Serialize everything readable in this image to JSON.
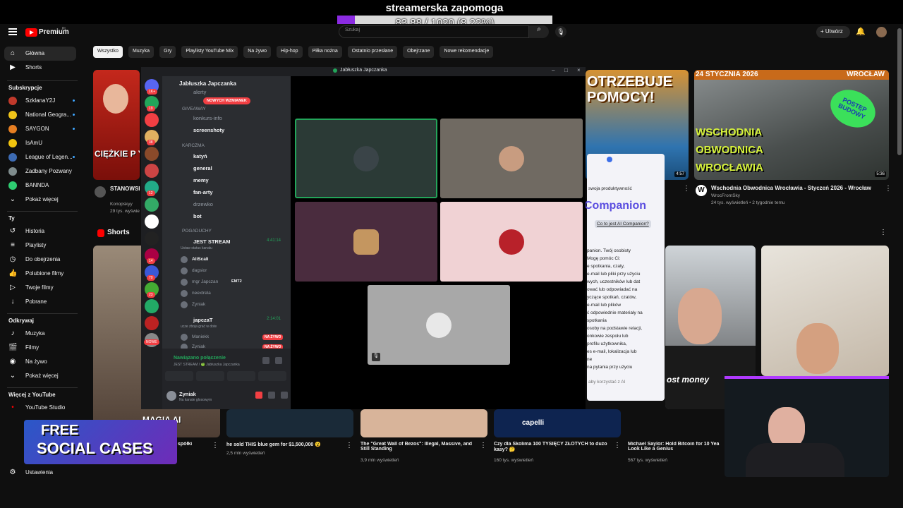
{
  "stream": {
    "title": "streamerska zapomoga",
    "progress_label": "83.88 / 1020 (8.22%)",
    "progress_fraction": 0.0822
  },
  "header": {
    "logo_text": "Premium",
    "country_code": "PL",
    "search_placeholder": "Szukaj",
    "create_label": "Utwórz",
    "icons": [
      "menu-icon",
      "search-icon",
      "mic-icon",
      "bell-icon",
      "avatar"
    ]
  },
  "sidebar": {
    "main": [
      {
        "label": "Główna",
        "icon": "home-icon",
        "active": true
      },
      {
        "label": "Shorts",
        "icon": "shorts-icon"
      }
    ],
    "subs_heading": "Subskrypcje",
    "subs": [
      {
        "label": "SzklanaY2J",
        "color": "#c0392b",
        "dot": true
      },
      {
        "label": "National Geogra...",
        "color": "#f0c419",
        "dot": true
      },
      {
        "label": "SAYGON",
        "color": "#e67e22",
        "dot": true
      },
      {
        "label": "IsAmU",
        "color": "#f1c40f",
        "dot": false
      },
      {
        "label": "League of Legen...",
        "color": "#3d6bb3",
        "dot": true
      },
      {
        "label": "Zadbany Pozwany",
        "color": "#7f8c8d",
        "dot": false
      },
      {
        "label": "BANNDA",
        "color": "#2ecc71",
        "dot": false
      }
    ],
    "subs_more": "Pokaż więcej",
    "you_heading": "Ty",
    "you": [
      {
        "label": "Historia",
        "icon": "history-icon"
      },
      {
        "label": "Playlisty",
        "icon": "playlist-icon"
      },
      {
        "label": "Do obejrzenia",
        "icon": "clock-icon"
      },
      {
        "label": "Polubione filmy",
        "icon": "like-icon"
      },
      {
        "label": "Twoje filmy",
        "icon": "video-icon"
      },
      {
        "label": "Pobrane",
        "icon": "download-icon"
      }
    ],
    "explore_heading": "Odkrywaj",
    "explore": [
      {
        "label": "Muzyka",
        "icon": "music-icon"
      },
      {
        "label": "Filmy",
        "icon": "film-icon"
      },
      {
        "label": "Na żywo",
        "icon": "live-icon"
      }
    ],
    "explore_more": "Pokaż więcej",
    "more_heading": "Więcej z YouTube",
    "more": [
      "YouTube Studio"
    ],
    "settings": "Ustawienia"
  },
  "chips": [
    "Wszystko",
    "Muzyka",
    "Gry",
    "Playlisty YouTube Mix",
    "Na żywo",
    "Hip-hop",
    "Piłka nożna",
    "Ostatnio przesłane",
    "Obejrzane",
    "Nowe rekomendacje"
  ],
  "videos_top": [
    {
      "thumb_text": "CIĘŻKIE P YOU",
      "title": "STANOWSK GRANDE CO",
      "channel": "Konopskyy",
      "meta": "29 tys. wyświetl"
    },
    {
      "thumb_text": "OTRZEBUJE POMOCY!",
      "duration": "4:57"
    },
    {
      "thumb_text": "24 STYCZNIA 2026",
      "thumb_text2": "WROCŁAW",
      "thumb_text3": "WSCHODNIA OBWODNICA WROCŁAWIA",
      "sticker": "POSTĘP BUDOWY",
      "duration": "5:36",
      "title": "Wschodnia Obwodnica Wrocławia - Styczeń 2026 - Wrocław",
      "channel": "WrocFromSky",
      "meta": "24 tys. wyświetleń • 2 tygodnie temu"
    }
  ],
  "shorts_label": "Shorts",
  "shorts": [
    {
      "title": "spółki",
      "meta": ""
    },
    {
      "title": "he sold THIS blue gem for $1,500,000 😮",
      "meta": "2,5 mln wyświetleń"
    },
    {
      "title": "The \"Great Wall of Bezos\": Illegal, Massive, and Still Standing",
      "meta": "3,9 mln wyświetleń"
    },
    {
      "title": "Czy dla Skolima 100 TYSIĘCY ZŁOTYCH to dużo kasy? 🤔",
      "meta": "160 tys. wyświetleń"
    },
    {
      "title": "Michael Saylor: Hold Bitcoin for 10 Yea Look Like a Genius",
      "meta": "567 tys. wyświetleń"
    }
  ],
  "shorts_overlay": [
    "MAGIA AI",
    "ost money"
  ],
  "discord": {
    "window_title": "Jabłuszka Japczanka",
    "server_name": "Jabłuszka Japczanka",
    "new_mentions": "NOWYCH WZMIANEK",
    "categories": {
      "giveaway": "GIVEAWAY",
      "karczma": "KARCZMA",
      "pogaduchy": "POGADUCHY"
    },
    "channels_top": [
      "alerty",
      "konkurs-info",
      "screenshoty"
    ],
    "channels_karczma": [
      "katyń",
      "general",
      "memy",
      "fan-arty",
      "drzewko",
      "bot"
    ],
    "voice1": {
      "name": "JEST STREAM",
      "time": "4:41:14",
      "status": "Ustaw status kanału"
    },
    "voice1_users": [
      "AliScali",
      "dagsior",
      "mgr Japczan",
      "neextrela",
      "Zyniak"
    ],
    "voice1_tag": "EMT2",
    "voice2": {
      "name": "japczaT",
      "time": "2:14:01",
      "status": "ucze zboja grać w dote"
    },
    "voice2_users": [
      "Maniekk",
      "Zyniak"
    ],
    "live_label": "NA ŻYWO",
    "new_label": "NOWE",
    "connected": "Nawiązano połączenie",
    "connected_sub": "JEST STREAM / 🍏 Jabłuszka Japczanka",
    "user_name": "Zyniak",
    "user_status": "Na kanale głosowym",
    "server_badges": [
      "1K+",
      "19",
      "38",
      "12",
      "14",
      "70",
      "23"
    ]
  },
  "companion": {
    "t1": "swoja produktywność",
    "t2": "Companion",
    "q": "Co to jest AI Companion?",
    "lines": [
      "panion. Twój osobisty",
      "Mogę pomóc Ci:",
      "e spotkania, czaty,",
      "e-mail lub pliki przy użyciu",
      "wych, uczestników lub dat",
      "ować lub odpowiadać na",
      "yczące spotkań, czatów,",
      "e-mail lub plików",
      "ć odpowiednie materiały na",
      "spotkania",
      "osoby na podstawie relacji,",
      "onkowie zespołu lub",
      "profilu użytkownika,",
      "es e-mail, lokalizacja lub",
      "ne",
      "na pytania przy użyciu"
    ],
    "input": "aby korzystać z AI"
  },
  "promo": {
    "line1": "FREE",
    "line2": "SOCIAL CASES"
  },
  "colors": {
    "accent": "#f00",
    "discord_green": "#23a55a",
    "discord_bg": "#2b2d31",
    "progress": "#8b2be2"
  }
}
